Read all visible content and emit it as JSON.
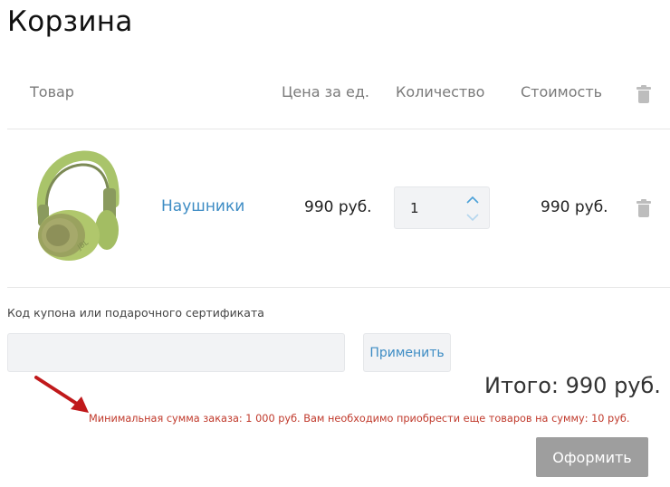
{
  "page": {
    "title": "Корзина"
  },
  "table": {
    "headers": {
      "product": "Товар",
      "unit_price": "Цена за ед.",
      "quantity": "Количество",
      "cost": "Стоимость"
    },
    "rows": [
      {
        "name": "Наушники",
        "unit_price": "990 руб.",
        "quantity": "1",
        "cost": "990 руб.",
        "image_icon": "headphones-image"
      }
    ]
  },
  "coupon": {
    "label": "Код купона или подарочного сертификата",
    "value": "",
    "placeholder": "",
    "apply_label": "Применить"
  },
  "summary": {
    "total": "Итого: 990 руб.",
    "min_order_notice": "Минимальная сумма заказа: 1 000 руб. Вам необходимо приобрести еще товаров на сумму: 10 руб.",
    "checkout_label": "Оформить"
  },
  "colors": {
    "link": "#3d8cc4",
    "warning": "#c0392b",
    "annotation_arrow": "#c0191b",
    "checkout_bg": "#9e9e9e"
  }
}
